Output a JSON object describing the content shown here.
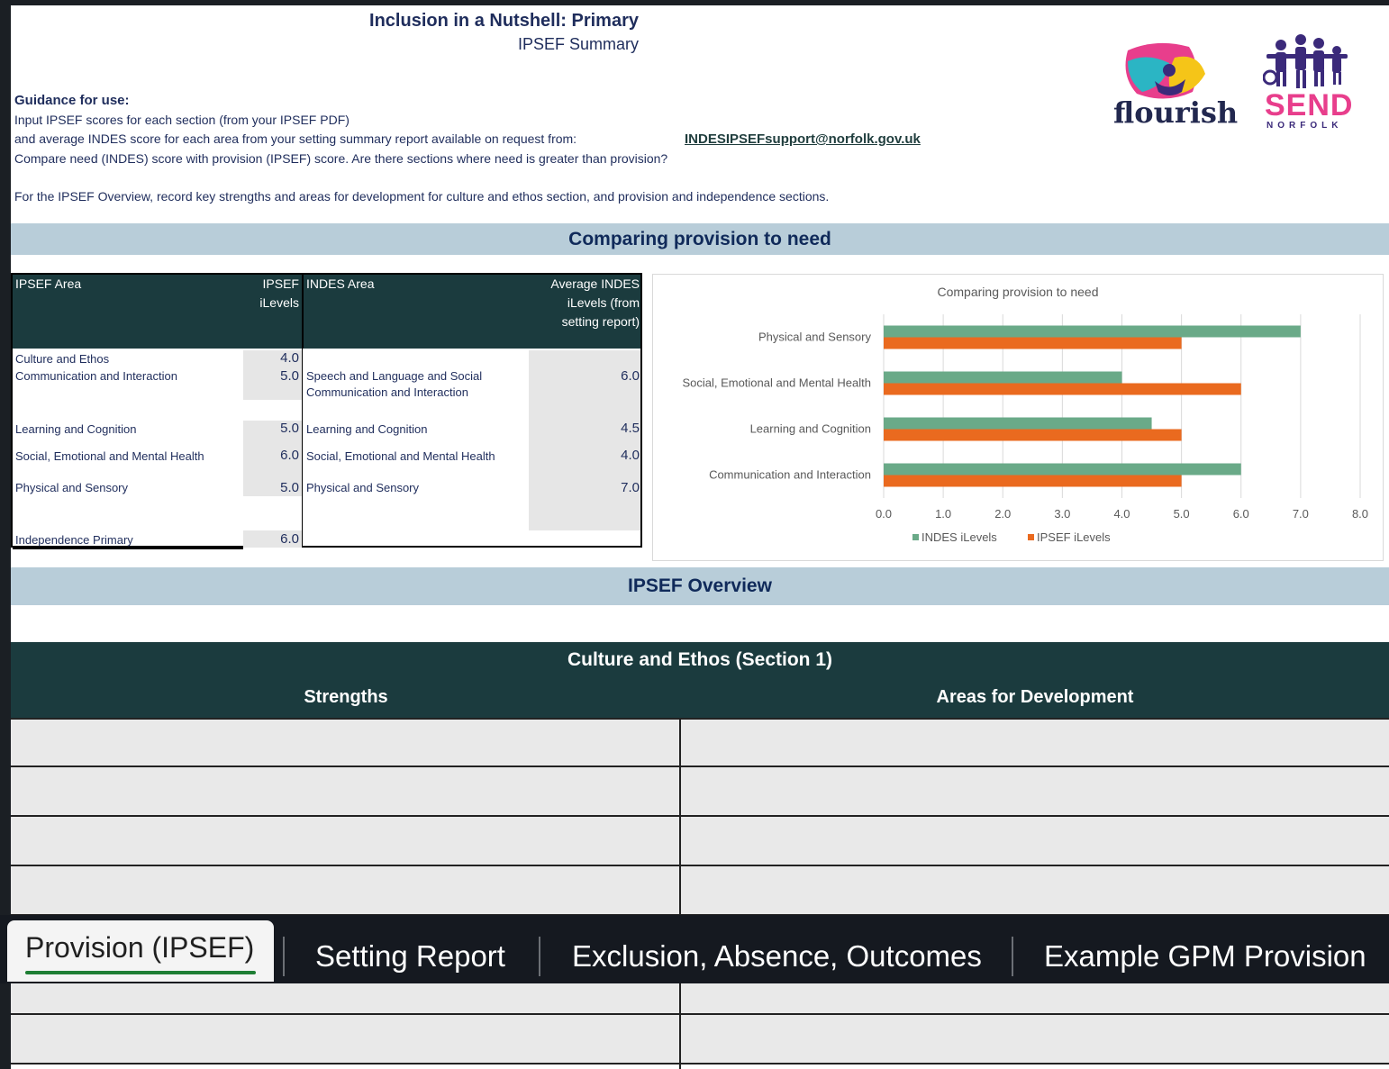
{
  "header": {
    "title": "Inclusion in a Nutshell: Primary",
    "subtitle": "IPSEF Summary",
    "logo_flourish": "flourish",
    "logo_send": "SEND",
    "logo_norfolk": "NORFOLK"
  },
  "guidance": {
    "heading": "Guidance for use:",
    "line1": "Input IPSEF scores for each section (from your IPSEF PDF)",
    "line2": "and average INDES score for each area from your setting summary report available on request from:",
    "email": "INDESIPSEFsupport@norfolk.gov.uk",
    "line3": "Compare need (INDES) score with provision (IPSEF) score.  Are there sections where need is greater than provision?",
    "line4": "For the IPSEF Overview, record key strengths and areas for development for culture and ethos section, and provision and independence sections."
  },
  "section_compare": "Comparing provision to need",
  "table": {
    "h_ipsef_area": "IPSEF Area",
    "h_ipsef_levels": "IPSEF iLevels",
    "h_indes_area": "INDES Area",
    "h_avg_indes": "Average INDES iLevels (from setting report)",
    "rows": [
      {
        "ipsef_area": "Culture and Ethos",
        "ipsef": "4.0",
        "indes_area": "",
        "indes": ""
      },
      {
        "ipsef_area": "Communication and Interaction",
        "ipsef": "5.0",
        "indes_area": "Speech and Language and Social Communication and Interaction",
        "indes": "6.0"
      },
      {
        "ipsef_area": "Learning and Cognition",
        "ipsef": "5.0",
        "indes_area": "Learning and Cognition",
        "indes": "4.5"
      },
      {
        "ipsef_area": "Social, Emotional and Mental Health",
        "ipsef": "6.0",
        "indes_area": "Social, Emotional and Mental Health",
        "indes": "4.0"
      },
      {
        "ipsef_area": "Physical and Sensory",
        "ipsef": "5.0",
        "indes_area": "Physical and Sensory",
        "indes": "7.0"
      },
      {
        "ipsef_area": "Independence Primary",
        "ipsef": "6.0",
        "indes_area": "",
        "indes": ""
      }
    ]
  },
  "chart_data": {
    "type": "bar",
    "orientation": "horizontal",
    "title": "Comparing provision to need",
    "categories": [
      "Physical and Sensory",
      "Social, Emotional and Mental Health",
      "Learning and Cognition",
      "Communication and Interaction"
    ],
    "series": [
      {
        "name": "INDES iLevels",
        "color": "#6aaa88",
        "values": [
          7.0,
          4.0,
          4.5,
          6.0
        ]
      },
      {
        "name": "IPSEF iLevels",
        "color": "#ea6a1f",
        "values": [
          5.0,
          6.0,
          5.0,
          5.0
        ]
      }
    ],
    "xlim": [
      0,
      8
    ],
    "ticks": [
      "0.0",
      "1.0",
      "2.0",
      "3.0",
      "4.0",
      "5.0",
      "6.0",
      "7.0",
      "8.0"
    ],
    "grid": true,
    "legend": "bottom"
  },
  "section_overview": "IPSEF Overview",
  "culture": {
    "heading": "Culture and Ethos (Section 1)",
    "strengths": "Strengths",
    "development": "Areas for Development"
  },
  "tabs": [
    {
      "label": "Provision (IPSEF)",
      "active": true
    },
    {
      "label": "Setting Report"
    },
    {
      "label": "Exclusion, Absence, Outcomes"
    },
    {
      "label": "Example GPM Provision"
    }
  ]
}
